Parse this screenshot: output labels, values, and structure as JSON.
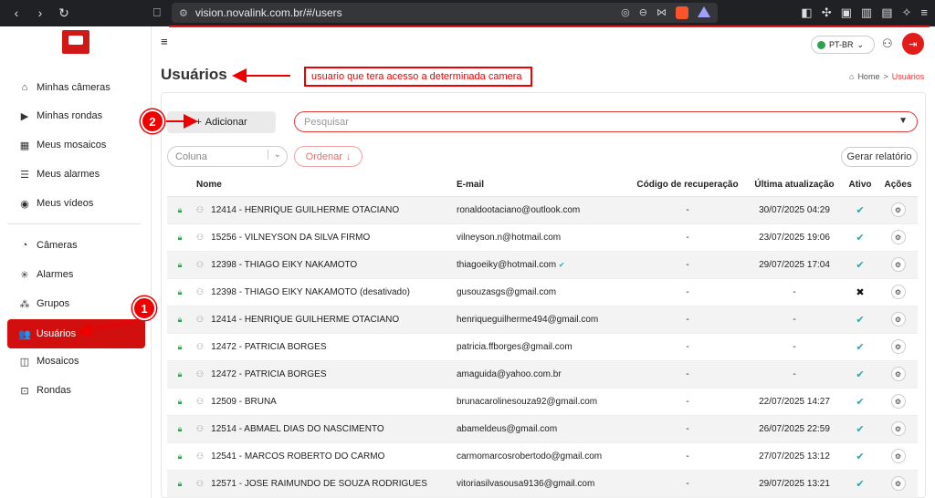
{
  "browser": {
    "url": "vision.novalink.com.br/#/users"
  },
  "sidebar": {
    "items": [
      {
        "label": "Minhas câmeras",
        "icon": "home-icon"
      },
      {
        "label": "Minhas rondas",
        "icon": "play-box-icon"
      },
      {
        "label": "Meus mosaicos",
        "icon": "grid-icon"
      },
      {
        "label": "Meus alarmes",
        "icon": "siren-icon"
      },
      {
        "label": "Meus vídeos",
        "icon": "play-circle-icon"
      },
      {
        "label": "Câmeras",
        "icon": "camera-icon"
      },
      {
        "label": "Alarmes",
        "icon": "alarm-icon"
      },
      {
        "label": "Grupos",
        "icon": "groups-icon"
      },
      {
        "label": "Usuários",
        "icon": "users-icon",
        "active": true
      },
      {
        "label": "Mosaicos",
        "icon": "mosaic-icon"
      },
      {
        "label": "Rondas",
        "icon": "rounds-icon"
      }
    ]
  },
  "topbar": {
    "language": "PT-BR"
  },
  "page": {
    "title": "Usuários",
    "annotation": "usuario que tera acesso a determinada camera",
    "breadcrumb_home": "Home",
    "breadcrumb_sep": ">",
    "breadcrumb_current": "Usuários"
  },
  "toolbar": {
    "add_label": "Adicionar",
    "search_placeholder": "Pesquisar",
    "column_placeholder": "Coluna",
    "order_label": "Ordenar",
    "report_label": "Gerar relatório"
  },
  "annotations": {
    "badge1": "1",
    "badge2": "2"
  },
  "table": {
    "headers": [
      "Nome",
      "E-mail",
      "Código de recuperação",
      "Última atualização",
      "Ativo",
      "Ações"
    ],
    "rows": [
      {
        "name": "12414 - HENRIQUE GUILHERME OTACIANO",
        "email": "ronaldootaciano@outlook.com",
        "code": "-",
        "updated": "30/07/2025 04:29",
        "active": true,
        "verified": false
      },
      {
        "name": "15256 - VILNEYSON DA SILVA FIRMO",
        "email": "vilneyson.n@hotmail.com",
        "code": "-",
        "updated": "23/07/2025 19:06",
        "active": true,
        "verified": false
      },
      {
        "name": "12398 - THIAGO EIKY NAKAMOTO",
        "email": "thiagoeiky@hotmail.com",
        "code": "-",
        "updated": "29/07/2025 17:04",
        "active": true,
        "verified": true
      },
      {
        "name": "12398 - THIAGO EIKY NAKAMOTO (desativado)",
        "email": "gusouzasgs@gmail.com",
        "code": "-",
        "updated": "-",
        "active": false,
        "verified": false
      },
      {
        "name": "12414 - HENRIQUE GUILHERME OTACIANO",
        "email": "henriqueguilherme494@gmail.com",
        "code": "-",
        "updated": "-",
        "active": true,
        "verified": false
      },
      {
        "name": "12472 - PATRICIA BORGES",
        "email": "patricia.ffborges@gmail.com",
        "code": "-",
        "updated": "-",
        "active": true,
        "verified": false
      },
      {
        "name": "12472 - PATRICIA BORGES",
        "email": "amaguida@yahoo.com.br",
        "code": "-",
        "updated": "-",
        "active": true,
        "verified": false
      },
      {
        "name": "12509 - BRUNA",
        "email": "brunacarolinesouza92@gmail.com",
        "code": "-",
        "updated": "22/07/2025 14:27",
        "active": true,
        "verified": false
      },
      {
        "name": "12514 - ABMAEL DIAS DO NASCIMENTO",
        "email": "abameldeus@gmail.com",
        "code": "-",
        "updated": "26/07/2025 22:59",
        "active": true,
        "verified": false
      },
      {
        "name": "12541 - MARCOS ROBERTO DO CARMO",
        "email": "carmomarcosrobertodo@gmail.com",
        "code": "-",
        "updated": "27/07/2025 13:12",
        "active": true,
        "verified": false
      },
      {
        "name": "12571 - JOSE RAIMUNDO DE SOUZA RODRIGUES",
        "email": "vitoriasilvasousa9136@gmail.com",
        "code": "-",
        "updated": "29/07/2025 13:21",
        "active": true,
        "verified": false
      }
    ]
  }
}
